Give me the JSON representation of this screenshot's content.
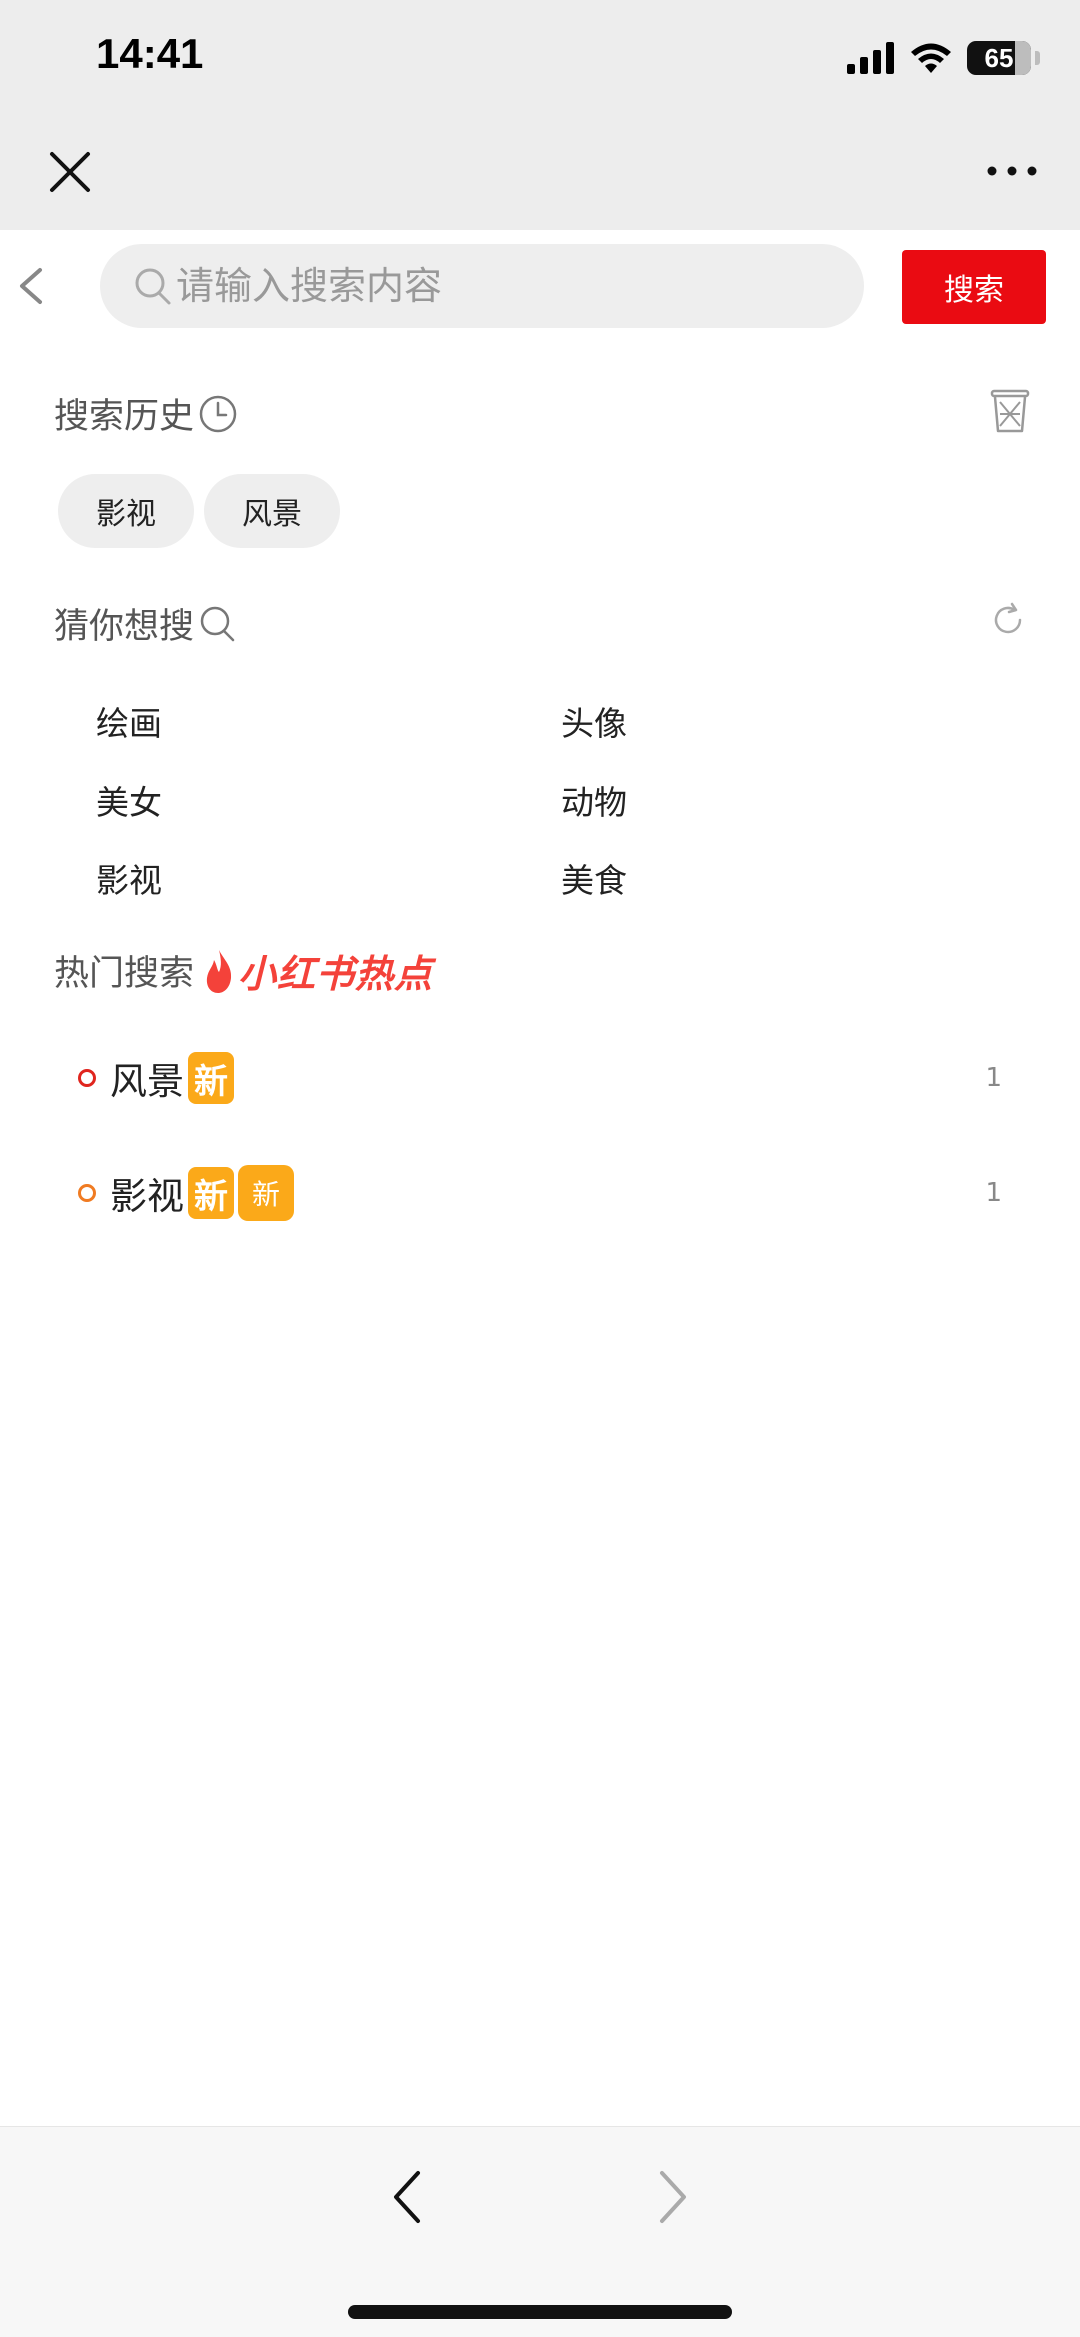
{
  "status_bar": {
    "time": "14:41",
    "battery": "65"
  },
  "nav": {
    "close_icon": "close-icon",
    "more_icon": "more-dots-icon"
  },
  "search": {
    "placeholder": "请输入搜索内容",
    "button_label": "搜索"
  },
  "history": {
    "title": "搜索历史",
    "items": [
      "影视",
      "风景"
    ]
  },
  "guess": {
    "title": "猜你想搜",
    "items": [
      "绘画",
      "头像",
      "美女",
      "动物",
      "影视",
      "美食"
    ]
  },
  "hot": {
    "title": "热门搜索",
    "brand": "小红书热点",
    "items": [
      {
        "label": "风景",
        "badges": [
          "新"
        ],
        "count": "1",
        "dot_color": "#e0251e"
      },
      {
        "label": "影视",
        "badges": [
          "新",
          "新"
        ],
        "count": "1",
        "dot_color": "#f07b22"
      }
    ]
  },
  "colors": {
    "accent": "#ea0b12",
    "badge": "#fba919",
    "brand": "#f4423a"
  }
}
